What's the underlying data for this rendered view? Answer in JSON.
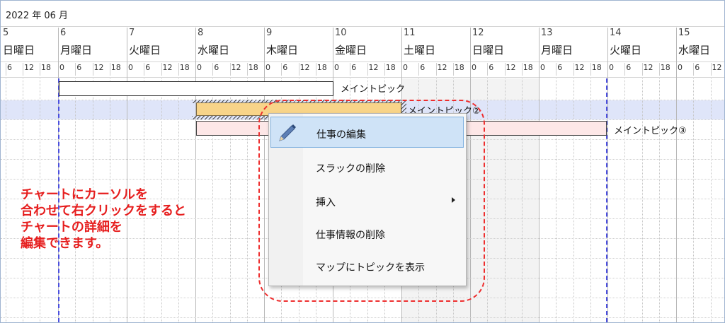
{
  "header": {
    "month_label": "2022 年 06 月"
  },
  "days": [
    {
      "num": "5",
      "name": "日曜日"
    },
    {
      "num": "6",
      "name": "月曜日"
    },
    {
      "num": "7",
      "name": "火曜日"
    },
    {
      "num": "8",
      "name": "水曜日"
    },
    {
      "num": "9",
      "name": "木曜日"
    },
    {
      "num": "10",
      "name": "金曜日"
    },
    {
      "num": "11",
      "name": "土曜日"
    },
    {
      "num": "12",
      "name": "日曜日"
    },
    {
      "num": "13",
      "name": "月曜日"
    },
    {
      "num": "14",
      "name": "火曜日"
    },
    {
      "num": "15",
      "name": "水曜日"
    }
  ],
  "hours_first_partial": [
    "6",
    "12",
    "18"
  ],
  "hours": [
    "0",
    "6",
    "12",
    "18"
  ],
  "hours_last_partial": [
    "0",
    "6",
    "12"
  ],
  "tasks": [
    {
      "label": "メイントピック",
      "fill": "#ffffff",
      "border": "#222222"
    },
    {
      "label": "メイントピック②",
      "fill": "#f8d489",
      "border": "#7a6a4a"
    },
    {
      "label": "メイントピック③",
      "fill": "#fde7e7",
      "border": "#444444"
    }
  ],
  "context_menu": {
    "items": [
      {
        "label": "仕事の編集",
        "selected": true
      },
      {
        "label": "スラックの削除"
      },
      {
        "label": "挿入",
        "submenu": true
      },
      {
        "label": "仕事情報の削除"
      },
      {
        "label": "マップにトピックを表示"
      }
    ]
  },
  "annotation": {
    "lines": [
      "チャートにカーソルを",
      "合わせて右クリックをすると",
      "チャートの詳細を",
      "編集できます。"
    ]
  },
  "colors": {
    "accent": "#e61e1e",
    "today_line": "#4b4fe0",
    "row_highlight": "#dfe5f9"
  }
}
